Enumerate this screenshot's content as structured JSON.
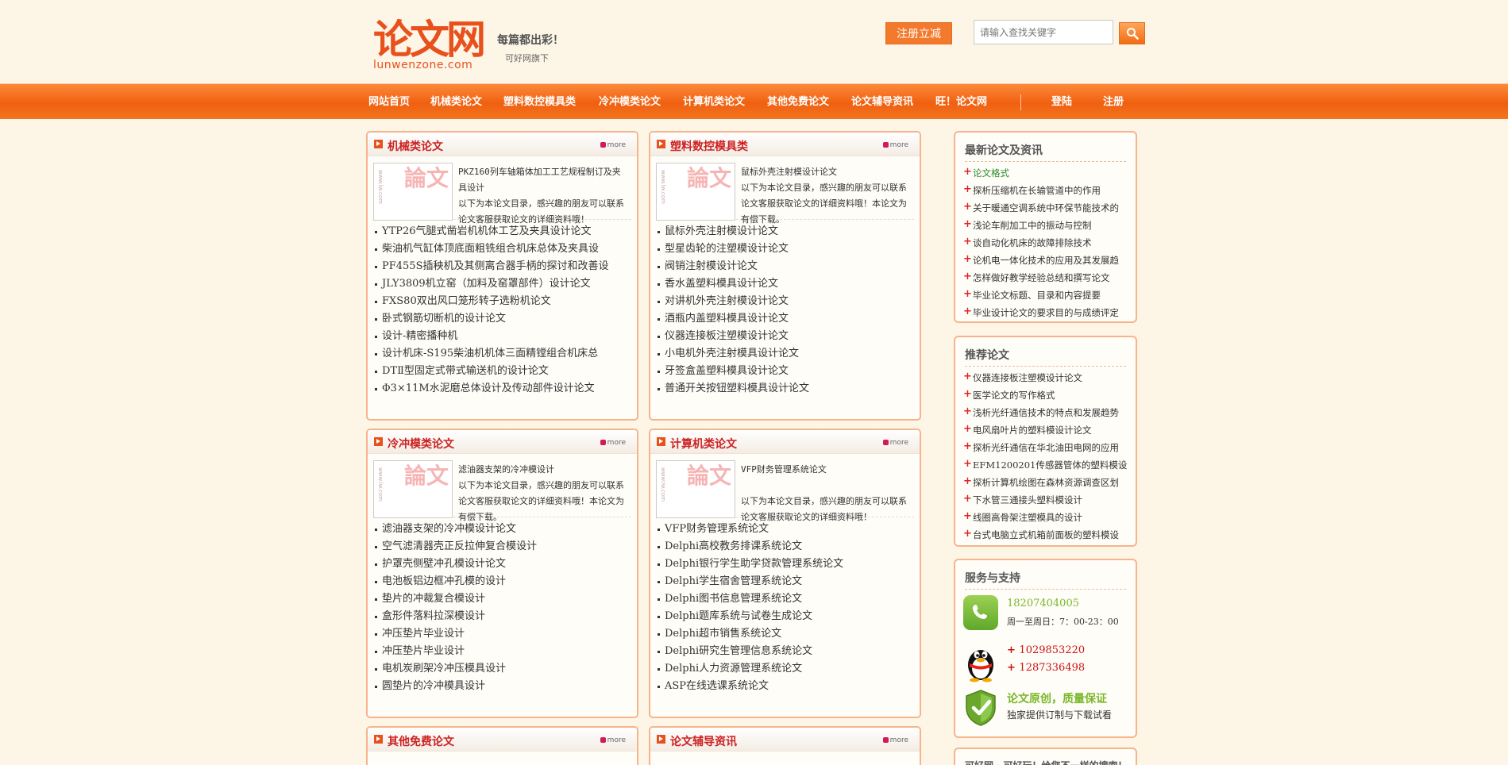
{
  "header": {
    "logo_cn": "论文网",
    "logo_en": "lunwenzone.com",
    "slogan_main": "每篇都出彩！",
    "slogan_sub": "可好网旗下",
    "register_button": "注册立减",
    "search_placeholder": "请输入查找关键字"
  },
  "nav": {
    "items": [
      "网站首页",
      "机械类论文",
      "塑料数控模具类",
      "冷冲模类论文",
      "计算机类论文",
      "其他免费论文",
      "论文辅导资讯",
      "旺！论文网"
    ],
    "login": "登陆",
    "register": "注册"
  },
  "sections": [
    {
      "title": "机械类论文",
      "more": "more",
      "thumb_text": "論文",
      "thumb_side": "www.lw.com",
      "feature_title": "PKZ160列车轴箱体加工工艺规程制订及夹具设计",
      "feature_desc": "以下为本论文目录，感兴趣的朋友可以联系论文客服获取论文的详细资料哦！",
      "items": [
        "YTP26气腿式凿岩机机体工艺及夹具设计论文",
        "柴油机气缸体顶底面粗铣组合机床总体及夹具设",
        "PF455S插秧机及其侧离合器手柄的探讨和改善设",
        "JLY3809机立窑（加料及窑罩部件）设计论文",
        "FXS80双出风口笼形转子选粉机论文",
        "卧式钢筋切断机的设计论文",
        "设计-精密播种机",
        "设计机床-S195柴油机机体三面精镗组合机床总",
        "DTⅡ型固定式带式输送机的设计论文",
        "Φ3×11M水泥磨总体设计及传动部件设计论文"
      ]
    },
    {
      "title": "塑料数控模具类",
      "more": "more",
      "thumb_text": "論文",
      "thumb_side": "www.lw.com",
      "feature_title": "鼠标外壳注射模设计论文",
      "feature_desc": "以下为本论文目录，感兴趣的朋友可以联系论文客服获取论文的详细资料哦！本论文为有偿下载。",
      "items": [
        "鼠标外壳注射模设计论文",
        "型星齿轮的注塑模设计论文",
        "阀销注射模设计论文",
        "香水盖塑料模具设计论文",
        "对讲机外壳注射模设计论文",
        "酒瓶内盖塑料模具设计论文",
        "仪器连接板注塑模设计论文",
        "小电机外壳注射模具设计论文",
        "牙签盒盖塑料模具设计论文",
        "普通开关按钮塑料模具设计论文"
      ]
    },
    {
      "title": "冷冲模类论文",
      "more": "more",
      "thumb_text": "論文",
      "thumb_side": "www.lw.com",
      "feature_title": "滤油器支架的冷冲模设计",
      "feature_desc": "以下为本论文目录，感兴趣的朋友可以联系论文客服获取论文的详细资料哦！本论文为有偿下载。",
      "items": [
        "滤油器支架的冷冲模设计论文",
        "空气滤清器壳正反拉伸复合模设计",
        "护罩壳侧壁冲孔模设计论文",
        "电池板铝边框冲孔模的设计",
        "垫片的冲裁复合模设计",
        "盒形件落料拉深模设计",
        "冲压垫片毕业设计",
        "冲压垫片毕业设计",
        "电机炭刷架冷冲压模具设计",
        "圆垫片的冷冲模具设计"
      ]
    },
    {
      "title": "计算机类论文",
      "more": "more",
      "thumb_text": "論文",
      "thumb_side": "www.lw.com",
      "feature_title": "VFP财务管理系统论文",
      "feature_desc": "以下为本论文目录，感兴趣的朋友可以联系论文客服获取论文的详细资料哦！",
      "items": [
        "VFP财务管理系统论文",
        "Delphi高校教务排课系统论文",
        "Delphi银行学生助学贷款管理系统论文",
        "Delphi学生宿舍管理系统论文",
        "Delphi图书信息管理系统论文",
        "Delphi题库系统与试卷生成论文",
        "Delphi超市销售系统论文",
        "Delphi研究生管理信息系统论文",
        "Delphi人力资源管理系统论文",
        "ASP在线选课系统论文"
      ]
    },
    {
      "title": "其他免费论文",
      "more": "more"
    },
    {
      "title": "论文辅导资讯",
      "more": "more"
    }
  ],
  "sidebar": {
    "latest": {
      "title": "最新论文及资讯",
      "items": [
        "论文格式",
        "探析压缩机在长输管道中的作用",
        "关于暖通空调系统中环保节能技术的",
        "浅论车削加工中的振动与控制",
        "谈自动化机床的故障排除技术",
        "论机电一体化技术的应用及其发展趋",
        "怎样做好教学经验总结和撰写论文",
        "毕业论文标题、目录和内容提要",
        "毕业设计论文的要求目的与成绩评定"
      ]
    },
    "recommended": {
      "title": "推荐论文",
      "items": [
        "仪器连接板注塑模设计论文",
        "医学论文的写作格式",
        "浅析光纤通信技术的特点和发展趋势",
        "电风扇叶片的塑料模设计论文",
        "探析光纤通信在华北油田电网的应用",
        "EFM1200201传感器管体的塑料模设计",
        "探析计算机绘图在森林资源调查区划",
        "下水管三通接头塑料模设计",
        "线圈高骨架注塑模具的设计",
        "台式电脑立式机箱前面板的塑料模设"
      ]
    },
    "service": {
      "title": "服务与支持",
      "phone": "18207404005",
      "hours": "周一至周日：7：00-23：00",
      "qq1": "1029853220",
      "qq2": "1287336498",
      "guarantee_title": "论文原创，质量保证",
      "guarantee_sub": "独家提供订制与下载试看"
    },
    "bottom_peek": "可好网 · 可好玩！给您不一样的搜索！"
  },
  "colors": {
    "accent": "#f06010",
    "title_red": "#cc2222",
    "background": "#fdf6e7",
    "green": "#7ab829"
  }
}
